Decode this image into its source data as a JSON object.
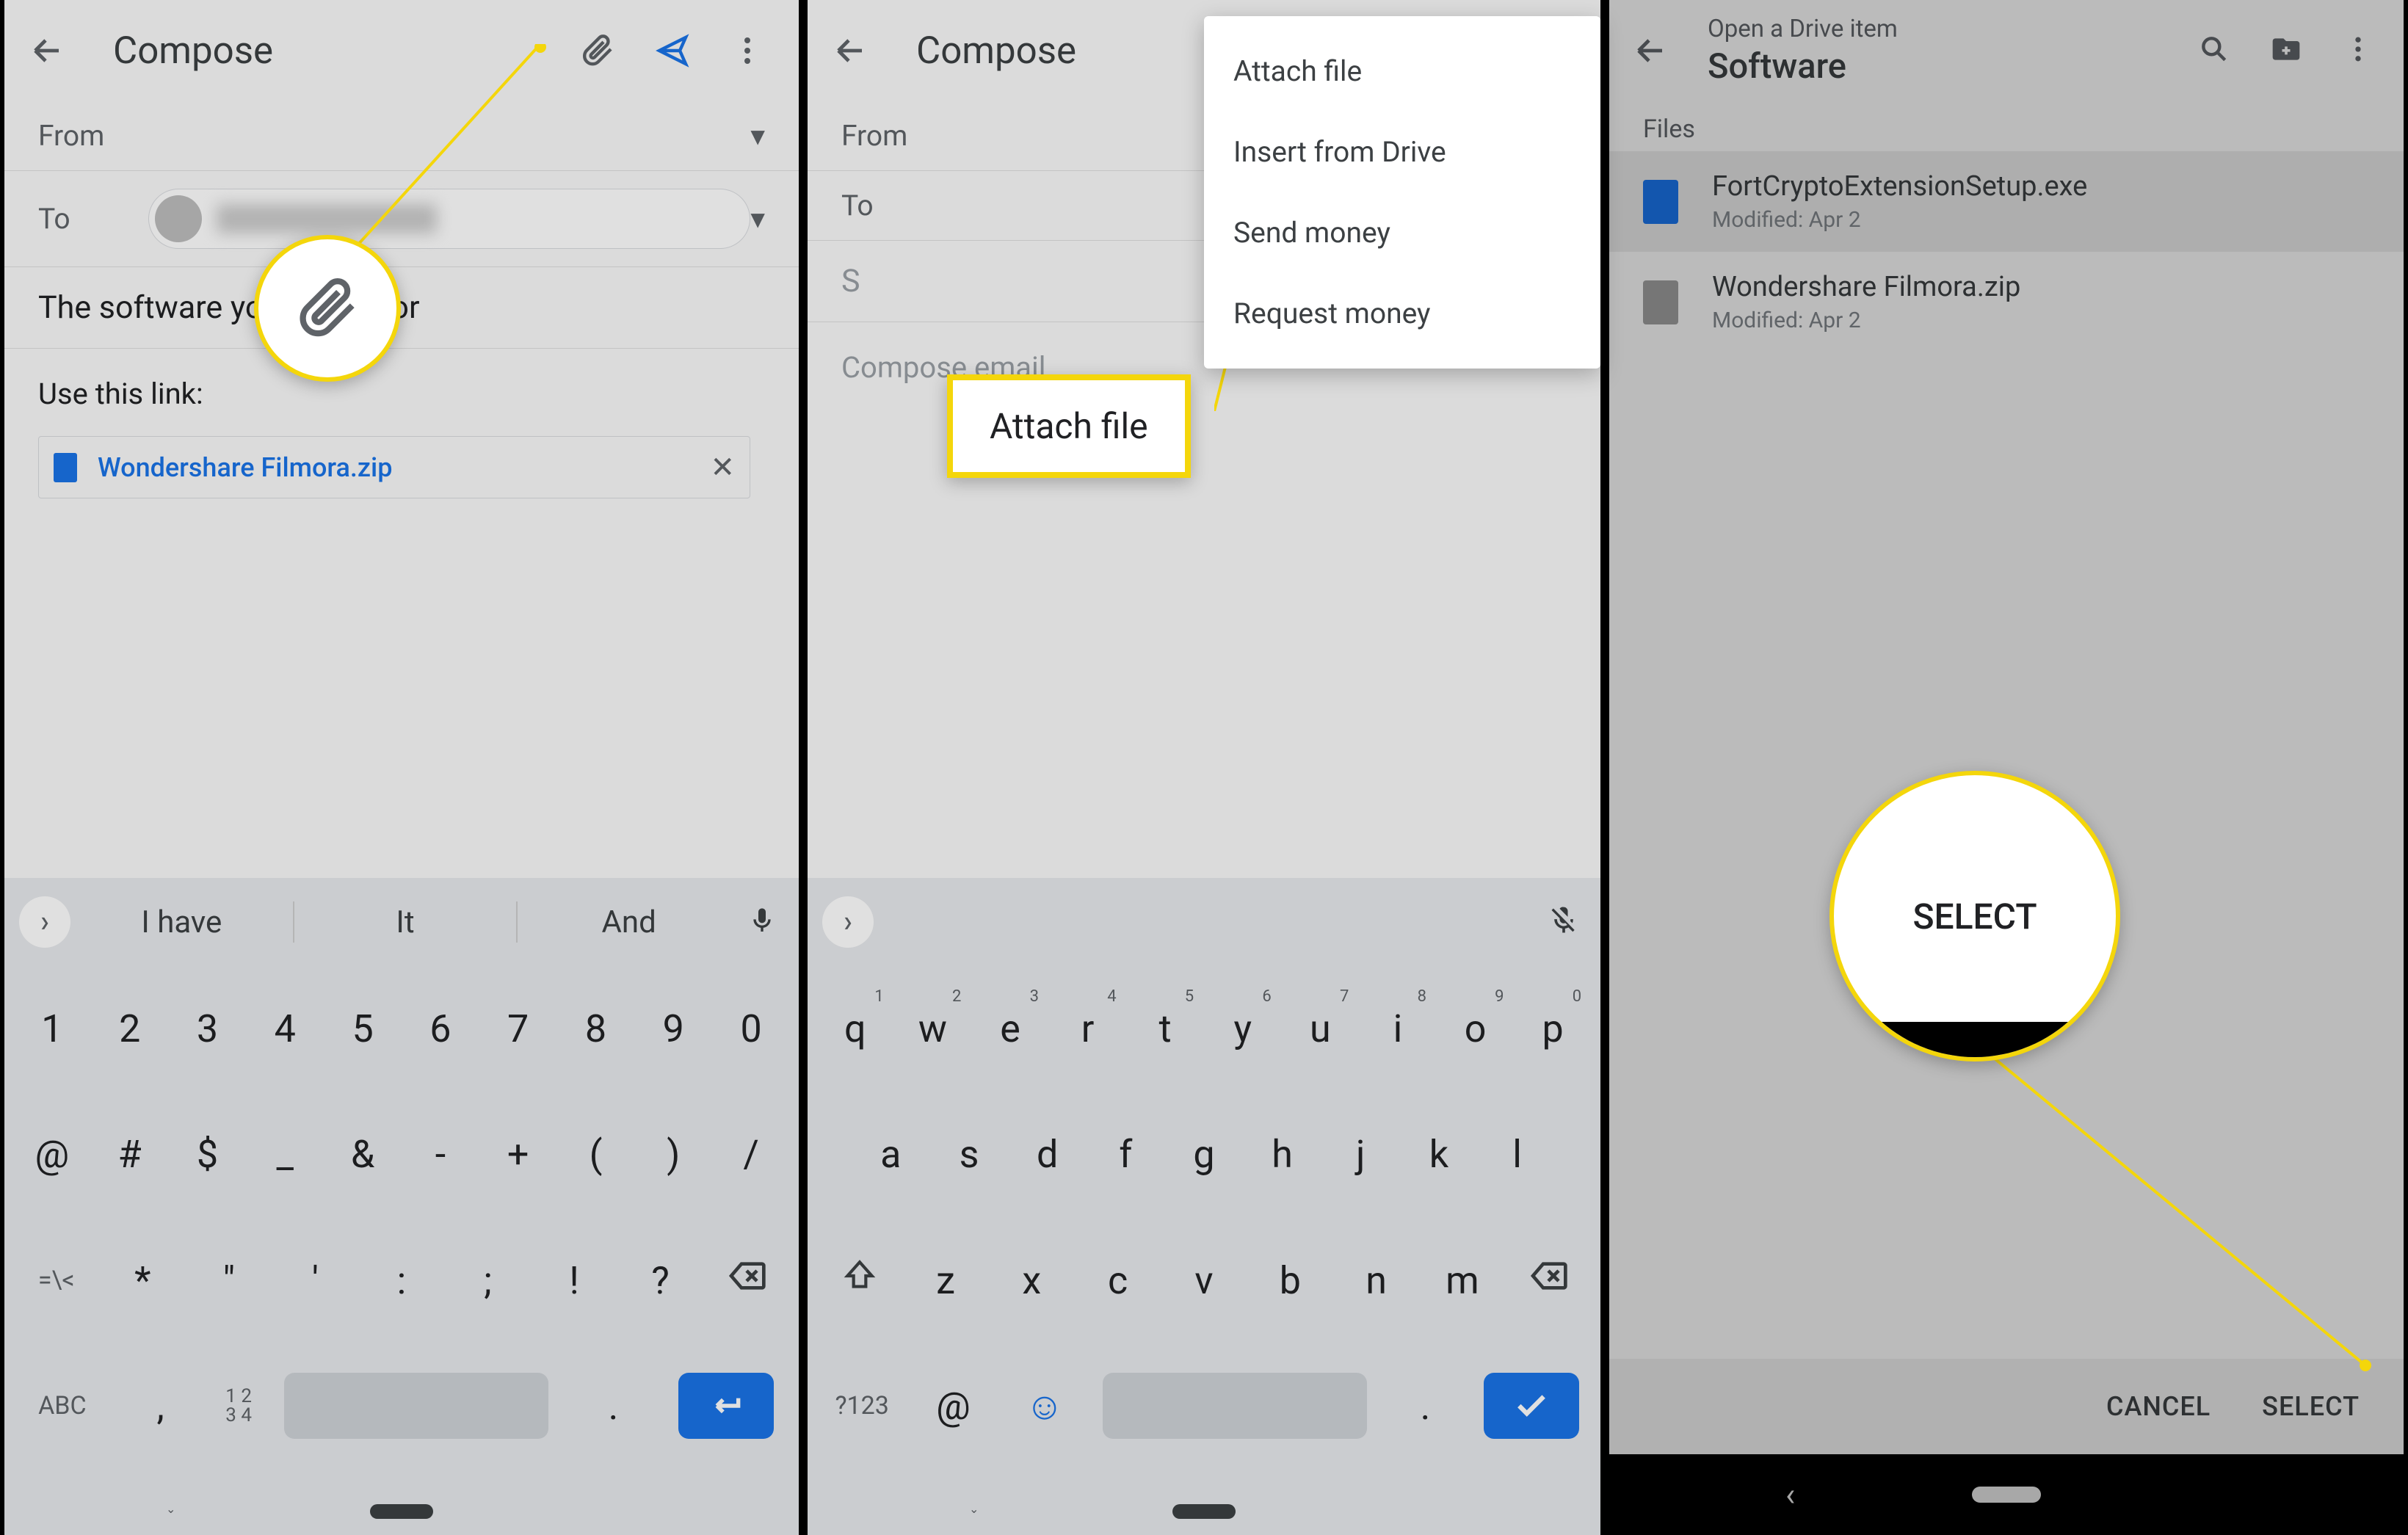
{
  "panel1": {
    "title": "Compose",
    "from_label": "From",
    "to_label": "To",
    "subject": "The software you asked for",
    "body": "Use this link:",
    "attachment": "Wondershare Filmora.zip",
    "suggestions": [
      "I have",
      "It",
      "And"
    ],
    "row1": [
      "1",
      "2",
      "3",
      "4",
      "5",
      "6",
      "7",
      "8",
      "9",
      "0"
    ],
    "row2": [
      "@",
      "#",
      "$",
      "_",
      "&",
      "-",
      "+",
      "(",
      ")",
      "/"
    ],
    "row3_lead": "=\\<",
    "row3": [
      "*",
      "\"",
      "'",
      ":",
      ";",
      "!",
      "?"
    ],
    "row4_abc": "ABC",
    "row4_nums": "1 2\n3 4"
  },
  "panel2": {
    "title": "Compose",
    "from_label": "From",
    "to_label": "To",
    "body_hint": "Compose email",
    "menu": [
      "Attach file",
      "Insert from Drive",
      "Send money",
      "Request money"
    ],
    "callout": "Attach file",
    "suggestions_blank": "",
    "row1_letters": [
      "q",
      "w",
      "e",
      "r",
      "t",
      "y",
      "u",
      "i",
      "o",
      "p"
    ],
    "row1_nums": [
      "1",
      "2",
      "3",
      "4",
      "5",
      "6",
      "7",
      "8",
      "9",
      "0"
    ],
    "row2": [
      "a",
      "s",
      "d",
      "f",
      "g",
      "h",
      "j",
      "k",
      "l"
    ],
    "row3": [
      "z",
      "x",
      "c",
      "v",
      "b",
      "n",
      "m"
    ],
    "row4_sym": "?123",
    "row4_at": "@"
  },
  "panel3": {
    "supertitle": "Open a Drive item",
    "title": "Software",
    "files_caption": "Files",
    "files": [
      {
        "name": "FortCryptoExtensionSetup.exe",
        "modified": "Modified: Apr 2",
        "type": "file"
      },
      {
        "name": "Wondershare Filmora.zip",
        "modified": "Modified: Apr 2",
        "type": "zip"
      }
    ],
    "cancel": "CANCEL",
    "select": "SELECT",
    "callout": "SELECT"
  }
}
